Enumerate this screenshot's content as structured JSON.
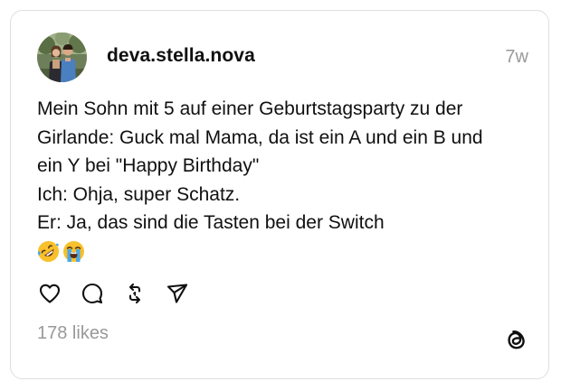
{
  "post": {
    "username": "deva.stella.nova",
    "time": "7w",
    "text_lines": [
      "Mein Sohn mit 5 auf einer Geburtstagsparty zu der",
      "Girlande: Guck mal Mama, da ist ein A und ein B und",
      "ein Y bei \"Happy Birthday\"",
      "Ich: Ohja, super Schatz.",
      "Er: Ja, das sind die Tasten bei der Switch"
    ],
    "emojis": [
      "rolling-on-floor-laughing-emoji",
      "loudly-crying-face-emoji"
    ],
    "likes": "178 likes"
  },
  "actions": [
    {
      "name": "like",
      "icon": "heart-icon"
    },
    {
      "name": "reply",
      "icon": "comment-icon"
    },
    {
      "name": "repost",
      "icon": "repost-icon"
    },
    {
      "name": "share",
      "icon": "send-icon"
    }
  ],
  "brand": {
    "logo": "threads-logo-icon"
  },
  "colors": {
    "text": "#101010",
    "muted": "#999999",
    "border": "#dedede",
    "emoji_yellow": "#f8c02a",
    "emoji_tear": "#4aa8ea"
  }
}
